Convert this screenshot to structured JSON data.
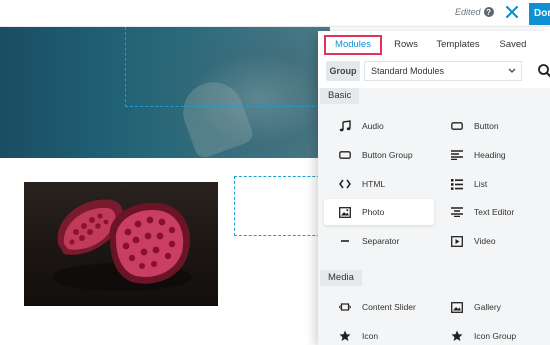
{
  "topbar": {
    "edited_label": "Edited",
    "help_glyph": "?",
    "done_label": "Done"
  },
  "panel": {
    "tabs": [
      {
        "label": "Modules",
        "active": true
      },
      {
        "label": "Rows",
        "active": false
      },
      {
        "label": "Templates",
        "active": false
      },
      {
        "label": "Saved",
        "active": false
      }
    ],
    "group_label": "Group",
    "group_value": "Standard Modules",
    "sections": [
      {
        "title": "Basic",
        "modules": [
          {
            "label": "Audio",
            "icon": "music-note-icon"
          },
          {
            "label": "Button",
            "icon": "button-icon"
          },
          {
            "label": "Button Group",
            "icon": "button-group-icon"
          },
          {
            "label": "Heading",
            "icon": "heading-icon"
          },
          {
            "label": "HTML",
            "icon": "code-icon"
          },
          {
            "label": "List",
            "icon": "list-icon"
          },
          {
            "label": "Photo",
            "icon": "photo-icon",
            "selected": true
          },
          {
            "label": "Text Editor",
            "icon": "text-editor-icon"
          },
          {
            "label": "Separator",
            "icon": "separator-icon"
          },
          {
            "label": "Video",
            "icon": "video-icon"
          }
        ]
      },
      {
        "title": "Media",
        "modules": [
          {
            "label": "Content Slider",
            "icon": "slider-icon"
          },
          {
            "label": "Gallery",
            "icon": "gallery-icon"
          },
          {
            "label": "Icon",
            "icon": "star-icon"
          },
          {
            "label": "Icon Group",
            "icon": "star-icon"
          }
        ]
      }
    ]
  },
  "colors": {
    "accent": "#0e90d2",
    "tab_highlight": "#e0325a",
    "panel_bg": "#f4f5f6",
    "hero_teal": "#1f5f74"
  }
}
